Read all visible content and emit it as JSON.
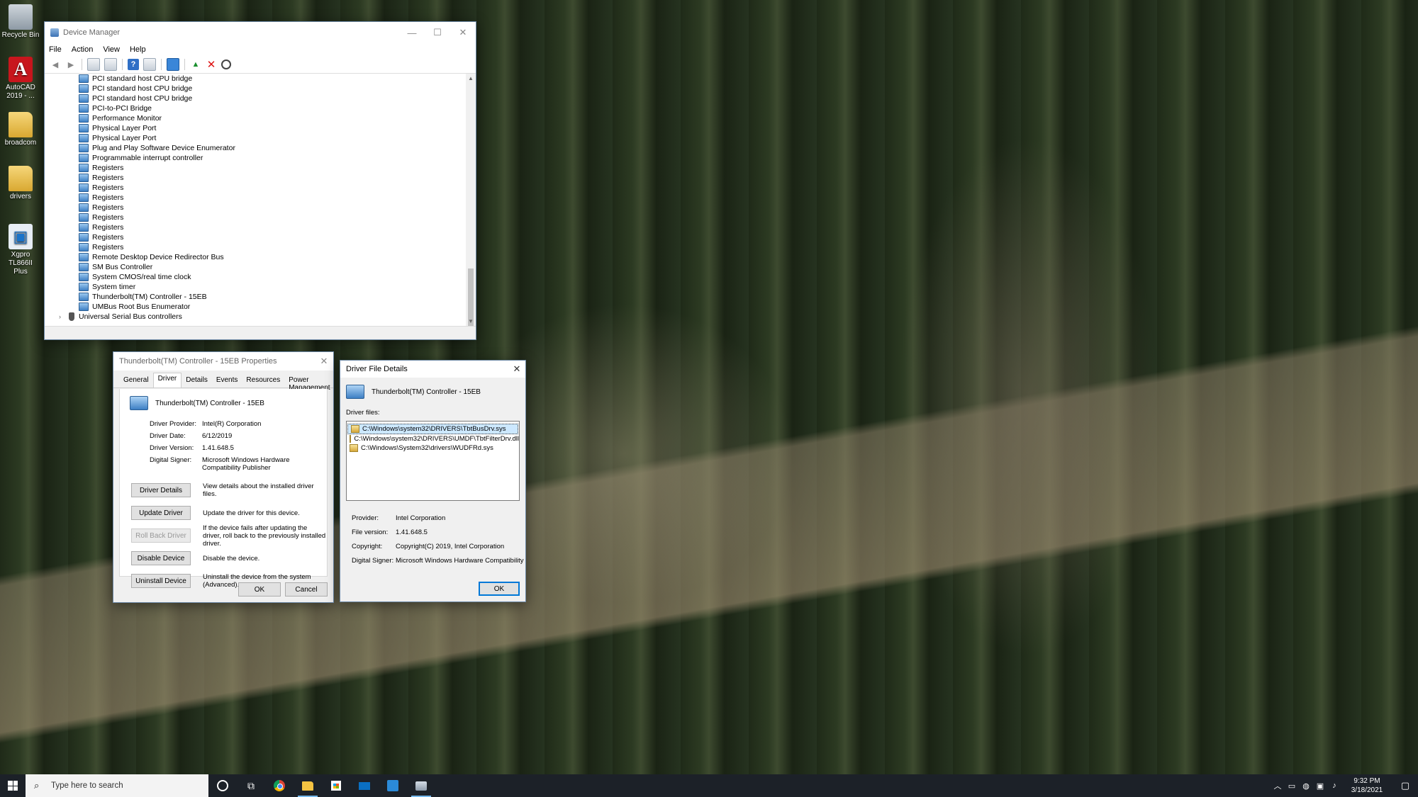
{
  "desktop": {
    "icons": [
      {
        "label": "Recycle Bin"
      },
      {
        "label": "AutoCAD 2019 - ..."
      },
      {
        "label": "broadcom"
      },
      {
        "label": "drivers"
      },
      {
        "label": "Xgpro TL866II Plus"
      }
    ]
  },
  "device_manager": {
    "title": "Device Manager",
    "menu": [
      "File",
      "Action",
      "View",
      "Help"
    ],
    "devices": [
      "PCI standard host CPU bridge",
      "PCI standard host CPU bridge",
      "PCI standard host CPU bridge",
      "PCI-to-PCI Bridge",
      "Performance Monitor",
      "Physical Layer Port",
      "Physical Layer Port",
      "Plug and Play Software Device Enumerator",
      "Programmable interrupt controller",
      "Registers",
      "Registers",
      "Registers",
      "Registers",
      "Registers",
      "Registers",
      "Registers",
      "Registers",
      "Registers",
      "Remote Desktop Device Redirector Bus",
      "SM Bus Controller",
      "System CMOS/real time clock",
      "System timer",
      "Thunderbolt(TM) Controller - 15EB",
      "UMBus Root Bus Enumerator"
    ],
    "category": "Universal Serial Bus controllers"
  },
  "properties": {
    "title": "Thunderbolt(TM) Controller - 15EB Properties",
    "tabs": [
      "General",
      "Driver",
      "Details",
      "Events",
      "Resources",
      "Power Management"
    ],
    "active_tab": "Driver",
    "device_name": "Thunderbolt(TM) Controller - 15EB",
    "info": [
      {
        "key": "Driver Provider:",
        "value": "Intel(R) Corporation"
      },
      {
        "key": "Driver Date:",
        "value": "6/12/2019"
      },
      {
        "key": "Driver Version:",
        "value": "1.41.648.5"
      },
      {
        "key": "Digital Signer:",
        "value": "Microsoft Windows Hardware Compatibility Publisher"
      }
    ],
    "actions": [
      {
        "label": "Driver Details",
        "desc": "View details about the installed driver files."
      },
      {
        "label": "Update Driver",
        "desc": "Update the driver for this device."
      },
      {
        "label": "Roll Back Driver",
        "desc": "If the device fails after updating the driver, roll back to the previously installed driver."
      },
      {
        "label": "Disable Device",
        "desc": "Disable the device."
      },
      {
        "label": "Uninstall Device",
        "desc": "Uninstall the device from the system (Advanced)."
      }
    ],
    "ok": "OK",
    "cancel": "Cancel"
  },
  "driver_file_details": {
    "title": "Driver File Details",
    "device_name": "Thunderbolt(TM) Controller - 15EB",
    "files_label": "Driver files:",
    "files": [
      "C:\\Windows\\system32\\DRIVERS\\TbtBusDrv.sys",
      "C:\\Windows\\system32\\DRIVERS\\UMDF\\TbtFilterDrv.dll",
      "C:\\Windows\\System32\\drivers\\WUDFRd.sys"
    ],
    "props": [
      {
        "key": "Provider:",
        "value": "Intel Corporation"
      },
      {
        "key": "File version:",
        "value": "1.41.648.5"
      },
      {
        "key": "Copyright:",
        "value": "Copyright(C) 2019, Intel Corporation"
      },
      {
        "key": "Digital Signer:",
        "value": "Microsoft Windows Hardware Compatibility"
      }
    ],
    "ok": "OK"
  },
  "taskbar": {
    "search_placeholder": "Type here to search",
    "time": "9:32 PM",
    "date": "3/18/2021"
  }
}
